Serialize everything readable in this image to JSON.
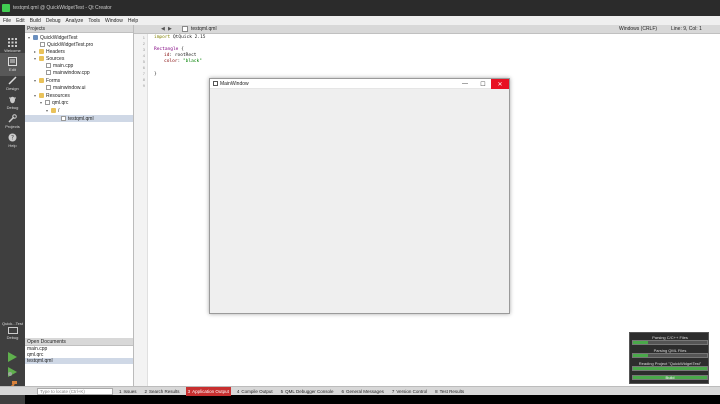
{
  "window": {
    "title": "testqml.qml @ QuickWidgetTest - Qt Creator"
  },
  "menu": [
    "File",
    "Edit",
    "Build",
    "Debug",
    "Analyze",
    "Tools",
    "Window",
    "Help"
  ],
  "modes": [
    {
      "label": "Welcome",
      "icon": "grid-icon"
    },
    {
      "label": "Edit",
      "icon": "edit-icon"
    },
    {
      "label": "Design",
      "icon": "pen-icon"
    },
    {
      "label": "Debug",
      "icon": "bug-icon"
    },
    {
      "label": "Projects",
      "icon": "wrench-icon"
    },
    {
      "label": "Help",
      "icon": "help-icon"
    }
  ],
  "projects": {
    "header": "Projects",
    "tree": [
      {
        "label": "QuickWidgetTest",
        "type": "proj"
      },
      {
        "label": "QuickWidgetTest.pro",
        "type": "file"
      },
      {
        "label": "Headers",
        "type": "folder"
      },
      {
        "label": "Sources",
        "type": "folder"
      },
      {
        "label": "main.cpp",
        "type": "file"
      },
      {
        "label": "mainwindow.cpp",
        "type": "file"
      },
      {
        "label": "Forms",
        "type": "folder"
      },
      {
        "label": "mainwindow.ui",
        "type": "file"
      },
      {
        "label": "Resources",
        "type": "folder"
      },
      {
        "label": "qml.qrc",
        "type": "file"
      },
      {
        "label": "/",
        "type": "folder"
      },
      {
        "label": "testqml.qml",
        "type": "file"
      }
    ]
  },
  "open_documents": {
    "header": "Open Documents",
    "items": [
      "main.cpp",
      "qml.qrc",
      "testqml.qml"
    ]
  },
  "kit": {
    "label": "Quick...Test",
    "sub": "Debug"
  },
  "editor": {
    "tab": "testqml.qml",
    "line_ending": "Windows (CRLF)",
    "position": "Line: 9, Col: 1",
    "code": {
      "l1_kw": "import",
      "l1_rest": " QtQuick 2.15",
      "l3_type": "Rectangle",
      "l3_rest": " {",
      "l4_prop": "id",
      "l4_rest": ": rootRect",
      "l5_prop": "color",
      "l5_sep": ": ",
      "l5_str": "\"black\"",
      "l7": "}"
    }
  },
  "main_window": {
    "title": "MainWindow",
    "min": "—",
    "max": "☐",
    "close": "✕"
  },
  "locator": {
    "placeholder": "Type to locate (Ctrl+K)"
  },
  "output_tabs": [
    {
      "num": "1",
      "label": "Issues"
    },
    {
      "num": "2",
      "label": "Search Results"
    },
    {
      "num": "3",
      "label": "Application Output"
    },
    {
      "num": "4",
      "label": "Compile Output"
    },
    {
      "num": "5",
      "label": "QML Debugger Console"
    },
    {
      "num": "6",
      "label": "General Messages"
    },
    {
      "num": "7",
      "label": "Version Control"
    },
    {
      "num": "8",
      "label": "Test Results"
    }
  ],
  "progress": [
    {
      "label": "Parsing C/C++ Files",
      "bar_text": "",
      "fill": 0.2
    },
    {
      "label": "Parsing QML Files",
      "bar_text": "",
      "fill": 0.2
    },
    {
      "label": "Reading Project \"QuickWidgetTest\"",
      "bar_text": "",
      "fill": 1.0
    },
    {
      "label": "",
      "bar_text": "Build",
      "fill": 1.0
    }
  ]
}
